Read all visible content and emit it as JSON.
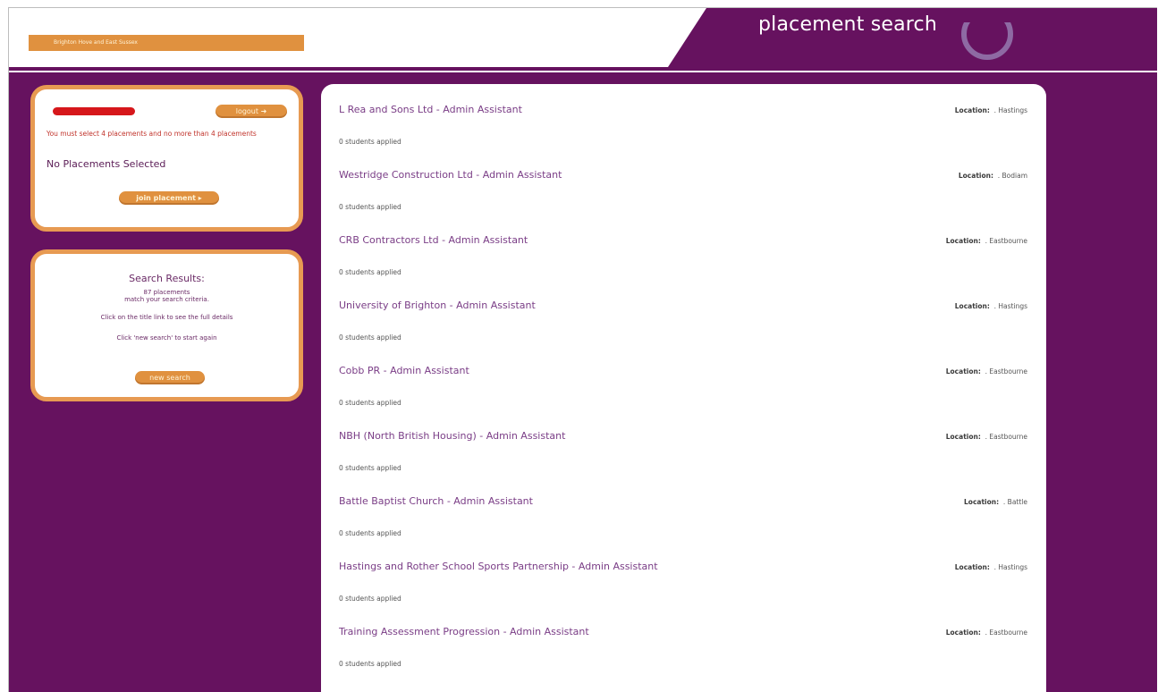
{
  "header": {
    "region_tab": "Brighton Hove and East Sussex",
    "page_title": "placement search"
  },
  "login_panel": {
    "logout_label": "logout",
    "warning": "You must select 4 placements and no more than 4 placements",
    "status": "No Placements Selected",
    "join_label": "join placement"
  },
  "results_panel": {
    "title": "Search Results:",
    "count_text": "87 placements",
    "match_text": "match your search criteria.",
    "hint_title": "Click on the title link to see the full details",
    "hint_new": "Click 'new search' to start again",
    "new_search_label": "new search"
  },
  "placements": [
    {
      "title": "L Rea and Sons Ltd - Admin Assistant",
      "location_label": "Location:",
      "location": ". Hastings",
      "applied": "0 students applied"
    },
    {
      "title": "Westridge Construction Ltd - Admin Assistant",
      "location_label": "Location:",
      "location": ". Bodiam",
      "applied": "0 students applied"
    },
    {
      "title": "CRB Contractors Ltd - Admin Assistant",
      "location_label": "Location:",
      "location": ". Eastbourne",
      "applied": "0 students applied"
    },
    {
      "title": "University of Brighton - Admin Assistant",
      "location_label": "Location:",
      "location": ". Hastings",
      "applied": "0 students applied"
    },
    {
      "title": "Cobb PR - Admin Assistant",
      "location_label": "Location:",
      "location": ". Eastbourne",
      "applied": "0 students applied"
    },
    {
      "title": "NBH (North British Housing) - Admin Assistant",
      "location_label": "Location:",
      "location": ". Eastbourne",
      "applied": "0 students applied"
    },
    {
      "title": "Battle Baptist Church - Admin Assistant",
      "location_label": "Location:",
      "location": ". Battle",
      "applied": "0 students applied"
    },
    {
      "title": "Hastings and Rother School Sports Partnership - Admin Assistant",
      "location_label": "Location:",
      "location": ". Hastings",
      "applied": "0 students applied"
    },
    {
      "title": "Training Assessment Progression - Admin Assistant",
      "location_label": "Location:",
      "location": ". Eastbourne",
      "applied": "0 students applied"
    }
  ],
  "colors": {
    "background_purple": "#66125f",
    "accent_orange": "#e0913f",
    "link_purple": "#7a3d86",
    "warning_red": "#c1342c"
  }
}
